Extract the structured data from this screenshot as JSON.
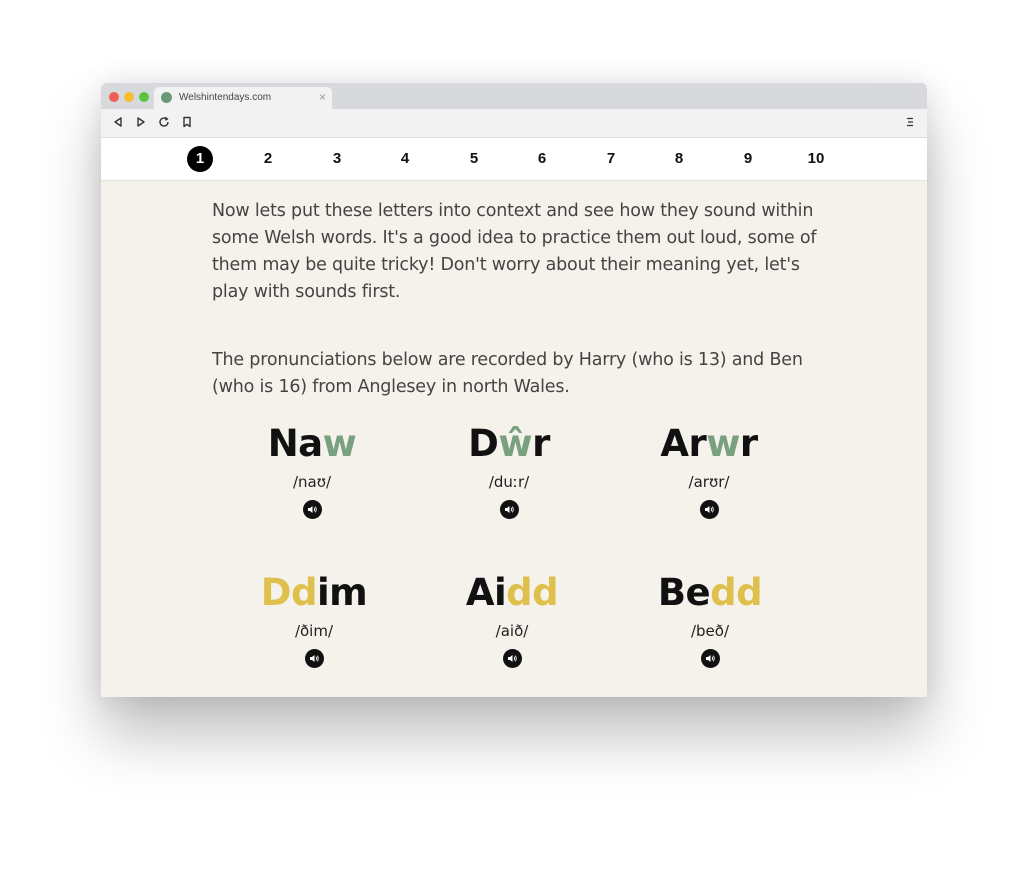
{
  "browser": {
    "tab_title": "Welshintendays.com",
    "tab_close": "×",
    "toolbar_icons": [
      "back-icon",
      "forward-icon",
      "reload-icon",
      "bookmark-icon",
      "menu-icon"
    ]
  },
  "nav": {
    "items": [
      "1",
      "2",
      "3",
      "4",
      "5",
      "6",
      "7",
      "8",
      "9",
      "10"
    ],
    "active_index": 0
  },
  "intro": {
    "paragraph_1": "Now lets put these letters into context and see how they sound within some Welsh words. It's a good idea to practice them out loud, some of them may be quite tricky! Don't worry about their meaning yet, let's play with sounds first.",
    "paragraph_2": "The pronunciations below are recorded by Harry (who is 13) and Ben (who is 16) from Anglesey in north Wales."
  },
  "colors": {
    "w_highlight": "#79a17f",
    "dd_highlight": "#e0c04d",
    "background": "#f5f2eb"
  },
  "words": [
    {
      "part1": "Na",
      "highlight": "w",
      "part2": "",
      "highlight_color": "green",
      "ipa": "/naʊ/"
    },
    {
      "part1": "D",
      "highlight": "ŵ",
      "part2": "r",
      "highlight_color": "green",
      "ipa": "/duːr/"
    },
    {
      "part1": "Ar",
      "highlight": "w",
      "part2": "r",
      "highlight_color": "green",
      "ipa": "/arʊr/"
    },
    {
      "part1": "",
      "highlight": "Dd",
      "part2": "im",
      "highlight_color": "gold",
      "ipa": "/ðim/"
    },
    {
      "part1": "Ai",
      "highlight": "dd",
      "part2": "",
      "highlight_color": "gold",
      "ipa": "/aið/"
    },
    {
      "part1": "Be",
      "highlight": "dd",
      "part2": "",
      "highlight_color": "gold",
      "ipa": "/beð/"
    }
  ]
}
